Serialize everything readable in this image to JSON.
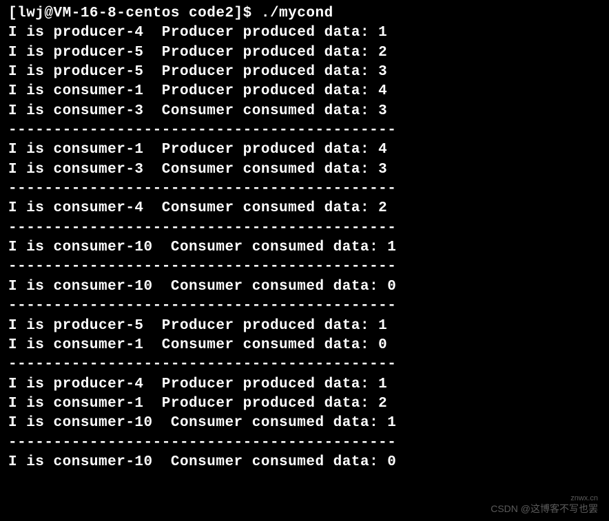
{
  "prompt": {
    "user": "lwj",
    "host": "VM-16-8-centos",
    "dir": "code2",
    "full": "[lwj@VM-16-8-centos code2]$ ./mycond"
  },
  "lines": [
    "I is producer-4  Producer produced data: 1",
    "I is producer-5  Producer produced data: 2",
    "I is producer-5  Producer produced data: 3",
    "I is consumer-1  Producer produced data: 4",
    "I is consumer-3  Consumer consumed data: 3",
    "-------------------------------------------",
    "I is consumer-1  Producer produced data: 4",
    "I is consumer-3  Consumer consumed data: 3",
    "-------------------------------------------",
    "I is consumer-4  Consumer consumed data: 2",
    "-------------------------------------------",
    "I is consumer-10  Consumer consumed data: 1",
    "-------------------------------------------",
    "I is consumer-10  Consumer consumed data: 0",
    "-------------------------------------------",
    "I is producer-5  Producer produced data: 1",
    "I is consumer-1  Consumer consumed data: 0",
    "-------------------------------------------",
    "I is producer-4  Producer produced data: 1",
    "I is consumer-1  Producer produced data: 2",
    "I is consumer-10  Consumer consumed data: 1",
    "-------------------------------------------",
    "I is consumer-10  Consumer consumed data: 0"
  ],
  "watermark": {
    "site": "znwx.cn",
    "text": "CSDN @这博客不写也罢"
  }
}
